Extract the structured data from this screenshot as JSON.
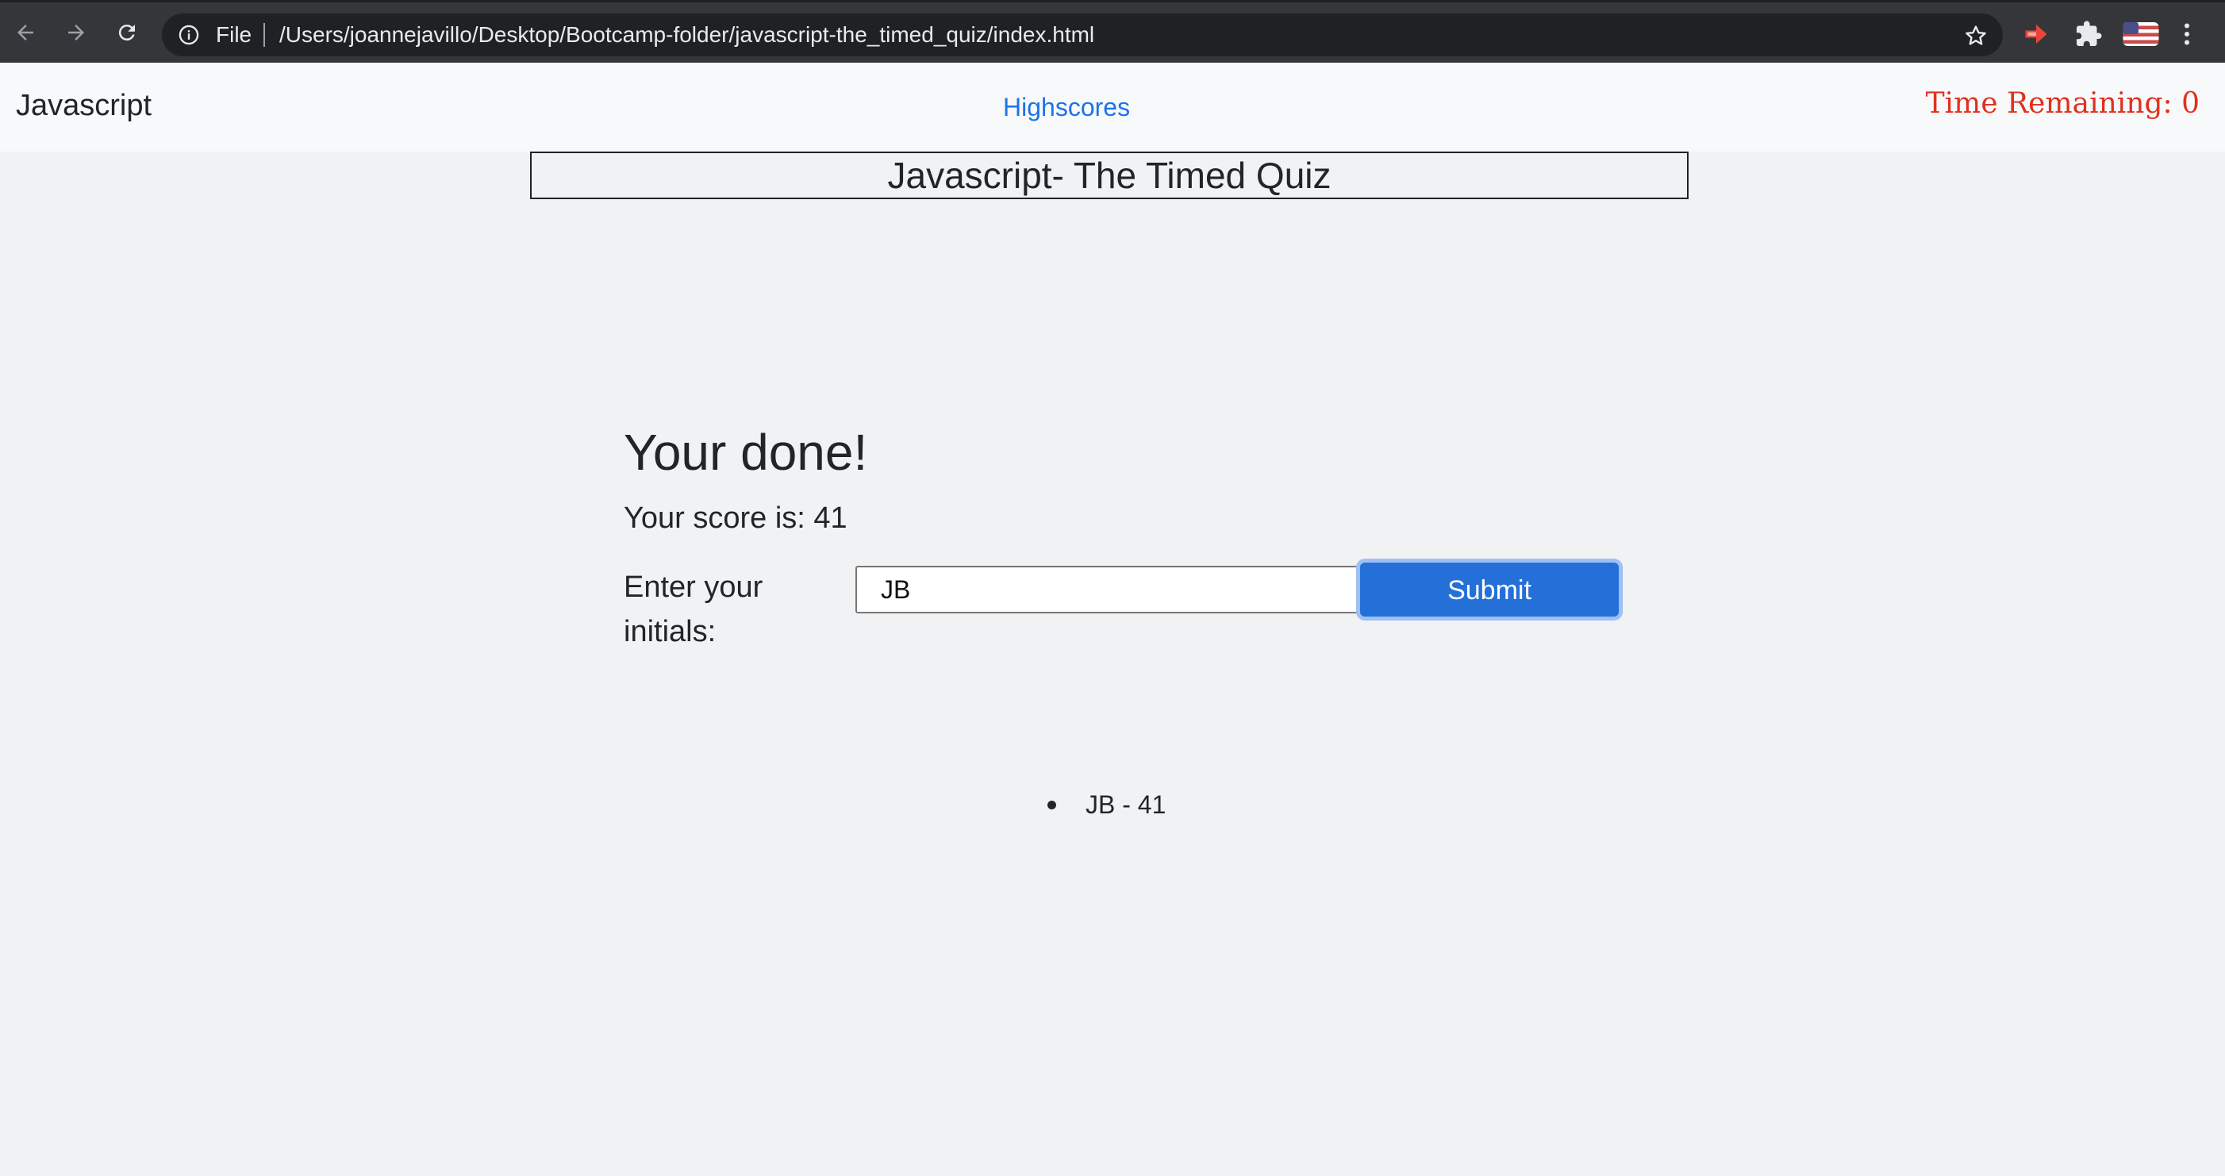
{
  "browser": {
    "scheme_label": "File",
    "url": "/Users/joannejavillo/Desktop/Bootcamp-folder/javascript-the_timed_quiz/index.html",
    "icons": [
      "back-arrow-icon",
      "forward-arrow-icon",
      "reload-icon",
      "info-icon",
      "bookmark-star-icon",
      "extension-arrow-icon",
      "puzzle-icon",
      "flag-avatar-icon",
      "kebab-menu-icon"
    ]
  },
  "navbar": {
    "brand": "Javascript",
    "link": "Highscores",
    "timer": "Time Remaining: 0"
  },
  "main": {
    "title": "Javascript- The Timed Quiz",
    "heading": "Your done!",
    "score_text": "Your score is: 41",
    "initials_label": "Enter your initials:",
    "initials_value": "JB",
    "submit_label": "Submit",
    "highscores": [
      "JB - 41"
    ]
  },
  "colors": {
    "link": "#1e73e8",
    "timer": "#e0301e",
    "submit_bg": "#2470d8",
    "page_bg": "#f1f2f4"
  }
}
